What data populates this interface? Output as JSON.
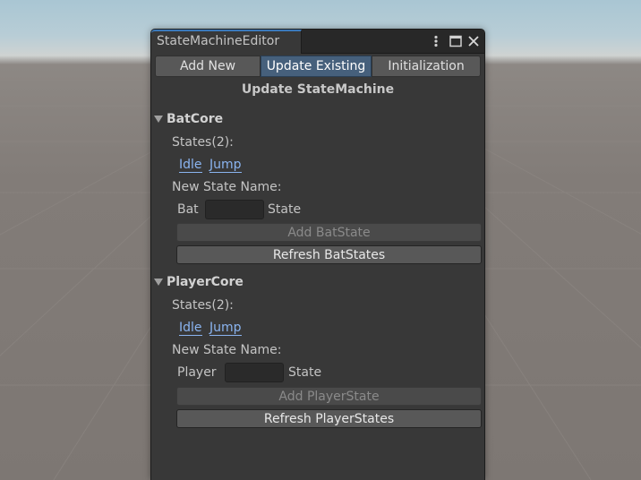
{
  "window": {
    "title": "StateMachineEditor",
    "more_icon": "kebab-menu-icon",
    "maximize_icon": "maximize-icon",
    "close_icon": "close-icon"
  },
  "toolbar": {
    "tabs": [
      {
        "label": "Add New",
        "selected": false
      },
      {
        "label": "Update Existing",
        "selected": true
      },
      {
        "label": "Initialization",
        "selected": false
      }
    ]
  },
  "heading": "Update StateMachine",
  "sections": [
    {
      "name": "BatCore",
      "expanded": true,
      "states_label": "States(2):",
      "states": [
        "Idle",
        "Jump"
      ],
      "new_state_label": "New State Name:",
      "prefix": "Bat",
      "input_value": "",
      "suffix": "State",
      "add_button": "Add BatState",
      "add_enabled": false,
      "refresh_button": "Refresh BatStates"
    },
    {
      "name": "PlayerCore",
      "expanded": true,
      "states_label": "States(2):",
      "states": [
        "Idle",
        "Jump"
      ],
      "new_state_label": "New State Name:",
      "prefix": "Player",
      "input_value": "",
      "suffix": "State",
      "add_button": "Add PlayerState",
      "add_enabled": false,
      "refresh_button": "Refresh PlayerStates"
    }
  ],
  "colors": {
    "window_bg": "#383838",
    "selected_tab": "#46607c",
    "link": "#8ab4f0",
    "tab_accent": "#3a79bb"
  }
}
